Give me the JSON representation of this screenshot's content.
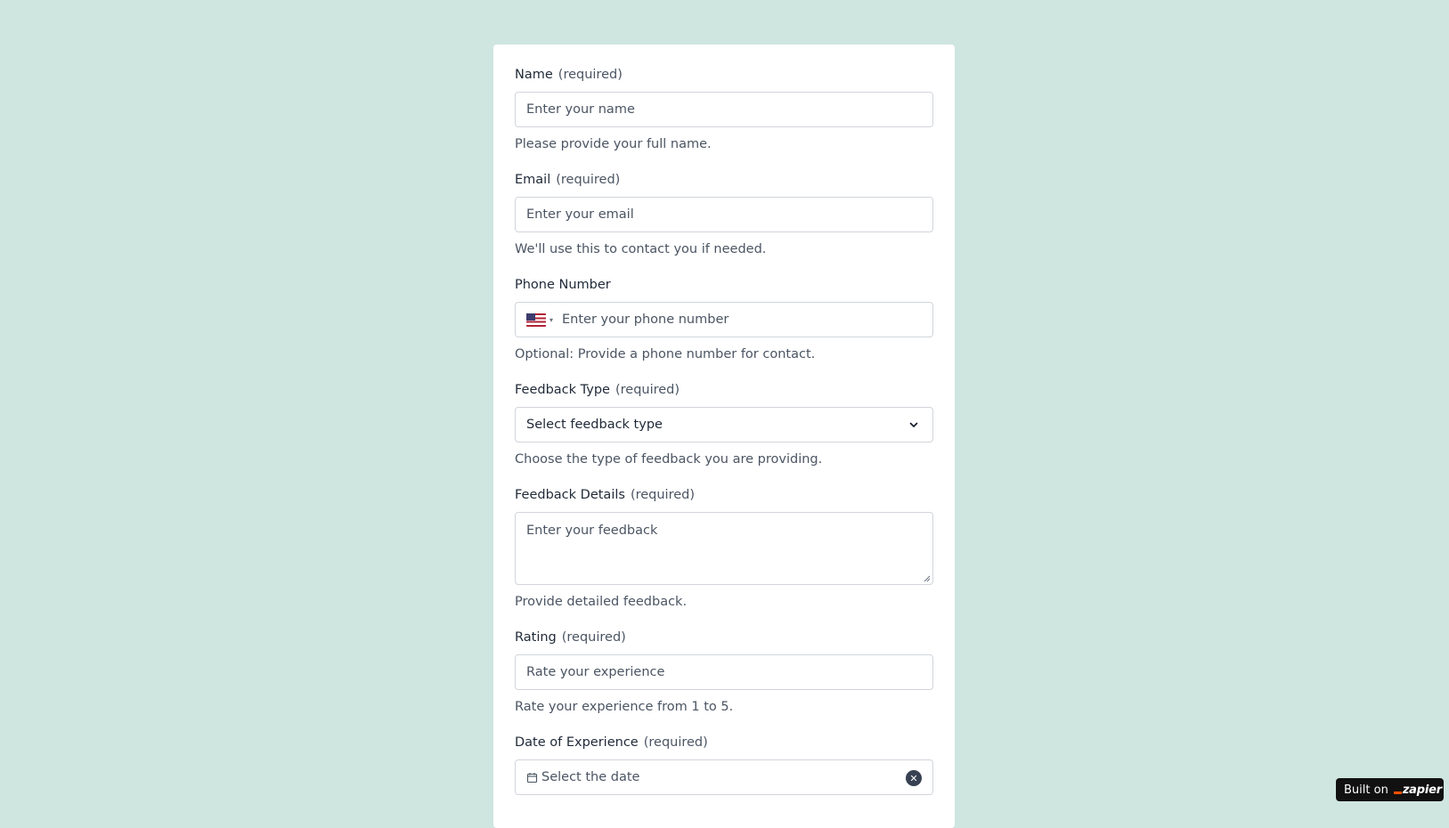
{
  "form": {
    "required_tag": "(required)",
    "name": {
      "label": "Name",
      "placeholder": "Enter your name",
      "help": "Please provide your full name."
    },
    "email": {
      "label": "Email",
      "placeholder": "Enter your email",
      "help": "We'll use this to contact you if needed."
    },
    "phone": {
      "label": "Phone Number",
      "placeholder": "Enter your phone number",
      "help": "Optional: Provide a phone number for contact.",
      "country_icon": "us-flag-icon"
    },
    "feedback_type": {
      "label": "Feedback Type",
      "selected": "Select feedback type",
      "help": "Choose the type of feedback you are providing."
    },
    "feedback_details": {
      "label": "Feedback Details",
      "placeholder": "Enter your feedback",
      "help": "Provide detailed feedback."
    },
    "rating": {
      "label": "Rating",
      "placeholder": "Rate your experience",
      "help": "Rate your experience from 1 to 5."
    },
    "date": {
      "label": "Date of Experience",
      "placeholder": "Select the date"
    }
  },
  "badge": {
    "prefix": "Built on",
    "brand": "zapier"
  },
  "colors": {
    "background": "#cfe5e0",
    "card": "#ffffff",
    "brand_accent": "#ff4f00"
  }
}
